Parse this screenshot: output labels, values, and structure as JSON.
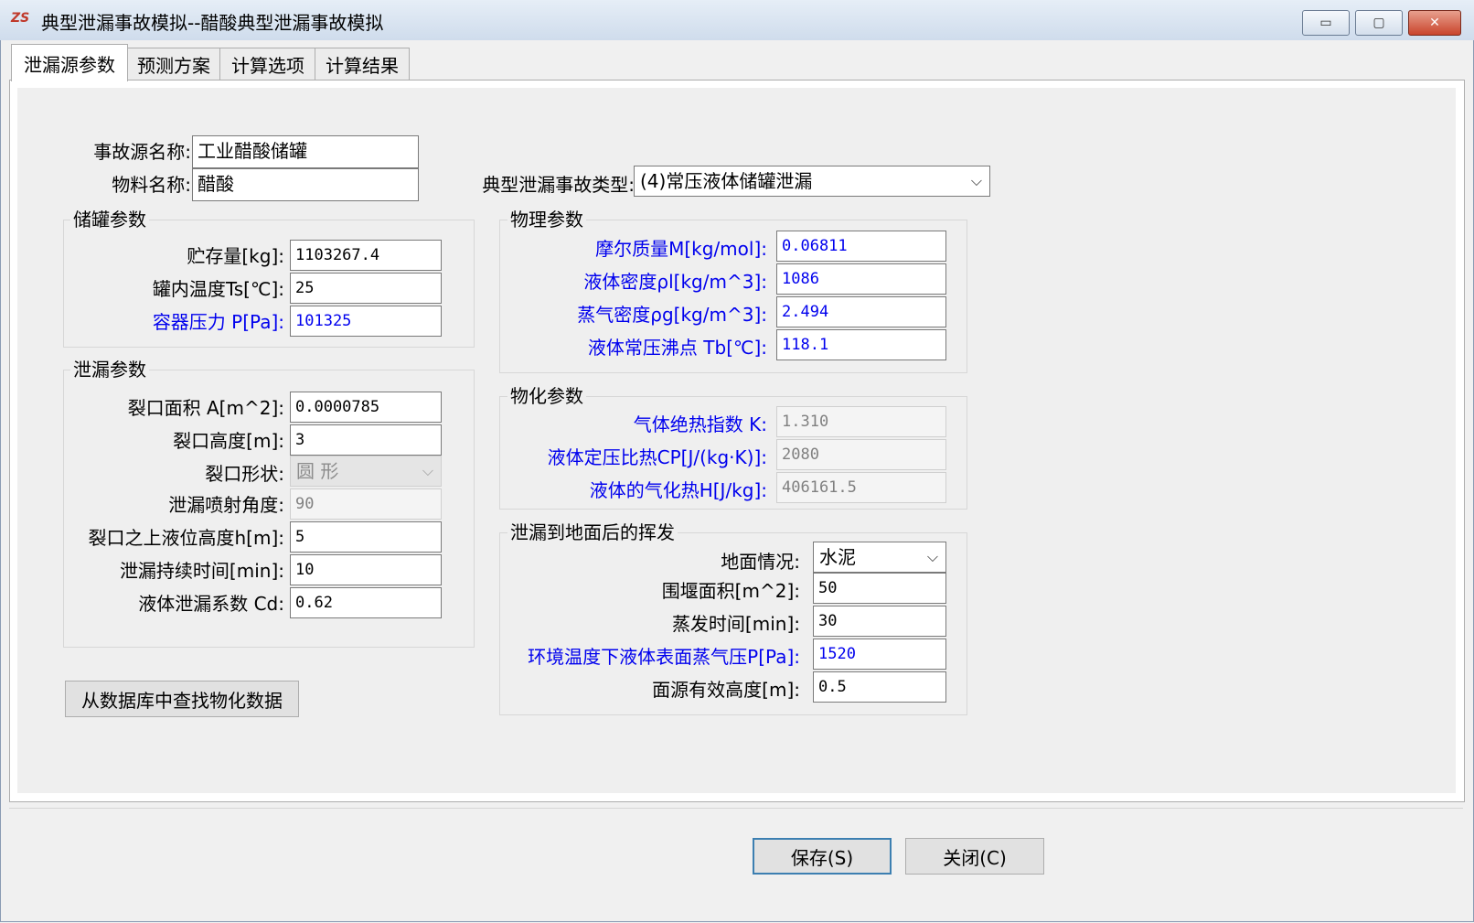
{
  "window": {
    "app_icon": "ZS",
    "title": "典型泄漏事故模拟--醋酸典型泄漏事故模拟",
    "minimize": "▭",
    "restore": "▢",
    "close": "✕"
  },
  "tabs": [
    "泄漏源参数",
    "预测方案",
    "计算选项",
    "计算结果"
  ],
  "source": {
    "name_label": "事故源名称:",
    "name_value": "工业醋酸储罐",
    "material_label": "物料名称:",
    "material_value": "醋酸",
    "type_label": "典型泄漏事故类型:",
    "type_value": "(4)常压液体储罐泄漏"
  },
  "tank": {
    "title": "储罐参数",
    "fields": [
      {
        "label": "贮存量[kg]:",
        "value": "1103267.4"
      },
      {
        "label": "罐内温度Ts[℃]:",
        "value": "25"
      },
      {
        "label": "容器压力 P[Pa]:",
        "value": "101325"
      }
    ]
  },
  "leak": {
    "title": "泄漏参数",
    "area_label": "裂口面积 A[m^2]:",
    "area_value": "0.0000785",
    "height_label": "裂口高度[m]:",
    "height_value": "3",
    "shape_label": "裂口形状:",
    "shape_value": "圆 形",
    "angle_label": "泄漏喷射角度:",
    "angle_value": "90",
    "level_label": "裂口之上液位高度h[m]:",
    "level_value": "5",
    "duration_label": "泄漏持续时间[min]:",
    "duration_value": "10",
    "coef_label": "液体泄漏系数 Cd:",
    "coef_value": "0.62"
  },
  "db_button": "从数据库中查找物化数据",
  "physical": {
    "title": "物理参数",
    "fields": [
      {
        "label": "摩尔质量M[kg/mol]:",
        "value": "0.06811"
      },
      {
        "label": "液体密度ρl[kg/m^3]:",
        "value": "1086"
      },
      {
        "label": "蒸气密度ρg[kg/m^3]:",
        "value": "2.494"
      },
      {
        "label": "液体常压沸点 Tb[℃]:",
        "value": "118.1"
      }
    ]
  },
  "chemical": {
    "title": "物化参数",
    "fields": [
      {
        "label": "气体绝热指数 K:",
        "value": "1.310"
      },
      {
        "label": "液体定压比热CP[J/(kg·K)]:",
        "value": "2080"
      },
      {
        "label": "液体的气化热H[J/kg]:",
        "value": "406161.5"
      }
    ]
  },
  "evaporation": {
    "title": "泄漏到地面后的挥发",
    "ground_label": "地面情况:",
    "ground_value": "水泥",
    "dike_label": "围堰面积[m^2]:",
    "dike_value": "50",
    "time_label": "蒸发时间[min]:",
    "time_value": "30",
    "vapor_label": "环境温度下液体表面蒸气压P[Pa]:",
    "vapor_value": "1520",
    "height_label": "面源有效高度[m]:",
    "height_value": "0.5"
  },
  "footer": {
    "save": "保存(S)",
    "close": "关闭(C)"
  },
  "icons": {
    "chevron": "⌵"
  }
}
